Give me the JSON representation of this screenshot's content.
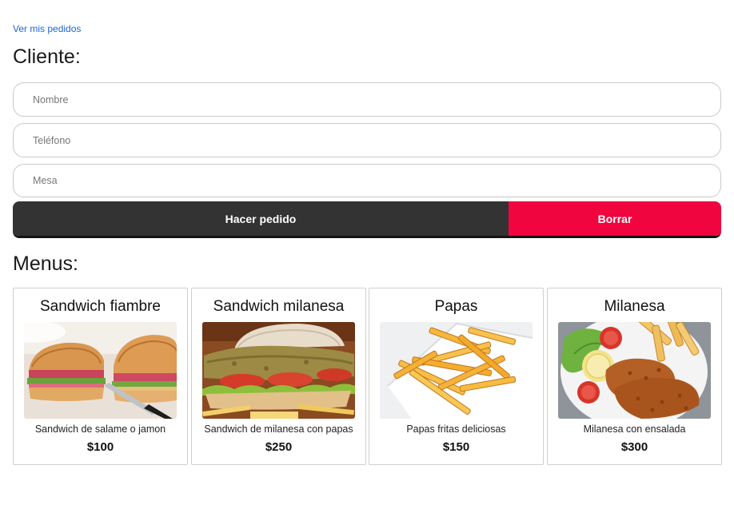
{
  "header": {
    "orders_link": "Ver mis pedidos",
    "client_heading": "Cliente:"
  },
  "form": {
    "name_placeholder": "Nombre",
    "phone_placeholder": "Teléfono",
    "table_placeholder": "Mesa"
  },
  "actions": {
    "submit_label": "Hacer pedido",
    "clear_label": "Borrar"
  },
  "colors": {
    "submit_bg": "#333333",
    "clear_bg": "#f0053f",
    "link": "#1a66d9"
  },
  "menus": {
    "heading": "Menus:",
    "items": [
      {
        "title": "Sandwich fiambre",
        "description": "Sandwich de salame o jamon",
        "price": "$100",
        "image": "sandwich-fiambre-image"
      },
      {
        "title": "Sandwich milanesa",
        "description": "Sandwich de milanesa con papas",
        "price": "$250",
        "image": "sandwich-milanesa-image"
      },
      {
        "title": "Papas",
        "description": "Papas fritas deliciosas",
        "price": "$150",
        "image": "papas-image"
      },
      {
        "title": "Milanesa",
        "description": "Milanesa con ensalada",
        "price": "$300",
        "image": "milanesa-image"
      }
    ]
  }
}
